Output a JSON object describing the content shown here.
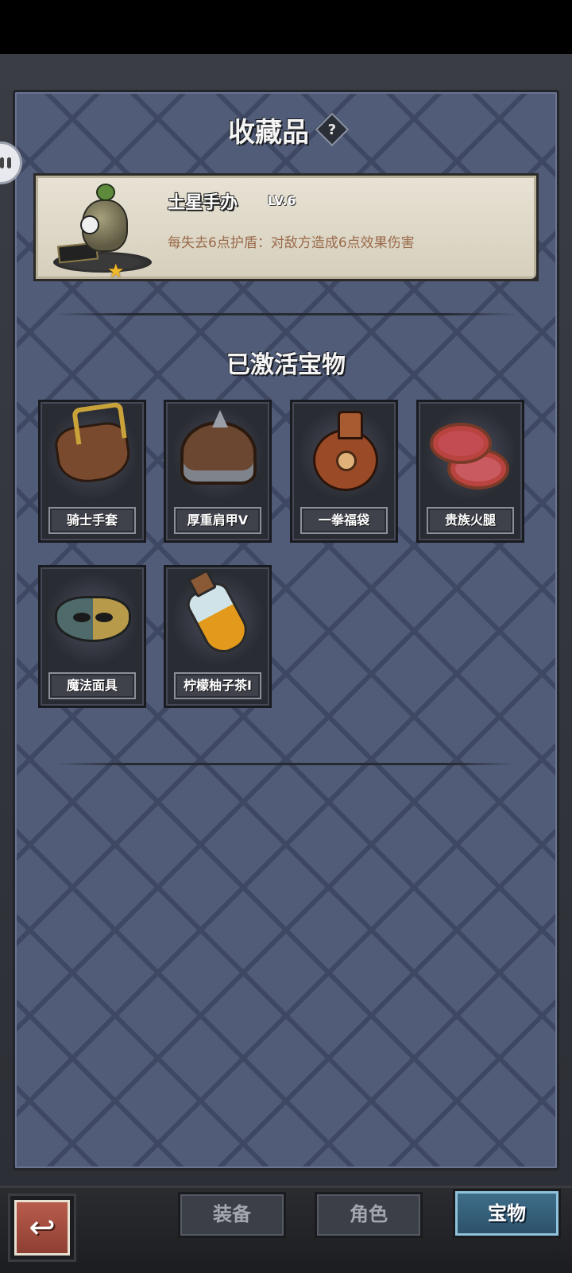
{
  "title": "收藏品",
  "help_icon": "question-mark-icon",
  "collectible": {
    "name": "土星手办",
    "level": "LV.6",
    "description": "每失去6点护盾：对敌方造成6点效果伤害",
    "rarity_icon": "star-icon"
  },
  "section_title": "已激活宝物",
  "treasures": [
    {
      "label": "骑士手套",
      "icon": "knight-glove-icon"
    },
    {
      "label": "厚重肩甲V",
      "icon": "pauldron-icon"
    },
    {
      "label": "一拳福袋",
      "icon": "lucky-bag-icon"
    },
    {
      "label": "贵族火腿",
      "icon": "ham-icon"
    },
    {
      "label": "魔法面具",
      "icon": "magic-mask-icon"
    },
    {
      "label": "柠檬柚子茶I",
      "icon": "tea-bottle-icon"
    }
  ],
  "tabs": [
    {
      "label": "装备",
      "active": false
    },
    {
      "label": "角色",
      "active": false
    },
    {
      "label": "宝物",
      "active": true
    }
  ],
  "back_icon": "back-arrow-icon",
  "colors": {
    "panel": "#515c78",
    "card": "#e7e2d4",
    "description": "#9a6a4a",
    "active_tab": "#3f6f8c"
  }
}
